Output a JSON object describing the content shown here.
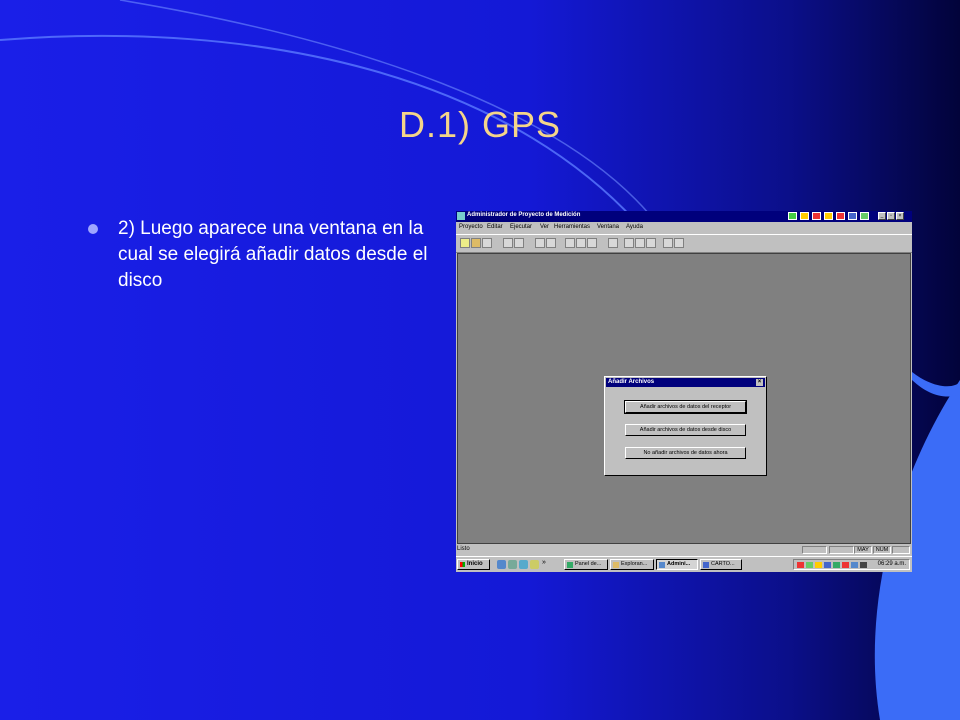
{
  "slide": {
    "title": "D.1)  GPS",
    "bullet": "2) Luego aparece una ventana en la cual se elegirá añadir datos desde el disco",
    "colors": {
      "background": "#1419d6",
      "title": "#f4d58a",
      "accent": "#3b6cf7"
    }
  },
  "app": {
    "title": "Administrador de Proyecto de Medición",
    "menu": [
      "Proyecto",
      "Editar",
      "Ejecutar",
      "Ver",
      "Herramientas",
      "Ventana",
      "Ayuda"
    ],
    "status": "Listo",
    "indicators": [
      "MAY",
      "NUM"
    ]
  },
  "dialog": {
    "title": "Añadir Archivos",
    "buttons": [
      "Añadir archivos de datos del receptor",
      "Añadir archivos de datos desde disco",
      "No añadir archivos de datos ahora"
    ]
  },
  "taskbar": {
    "start": "Inicio",
    "overflow": "»",
    "tasks": [
      "Panel de...",
      "Exploran...",
      "Admini...",
      "CARTO..."
    ],
    "clock": "06:29 a.m."
  }
}
